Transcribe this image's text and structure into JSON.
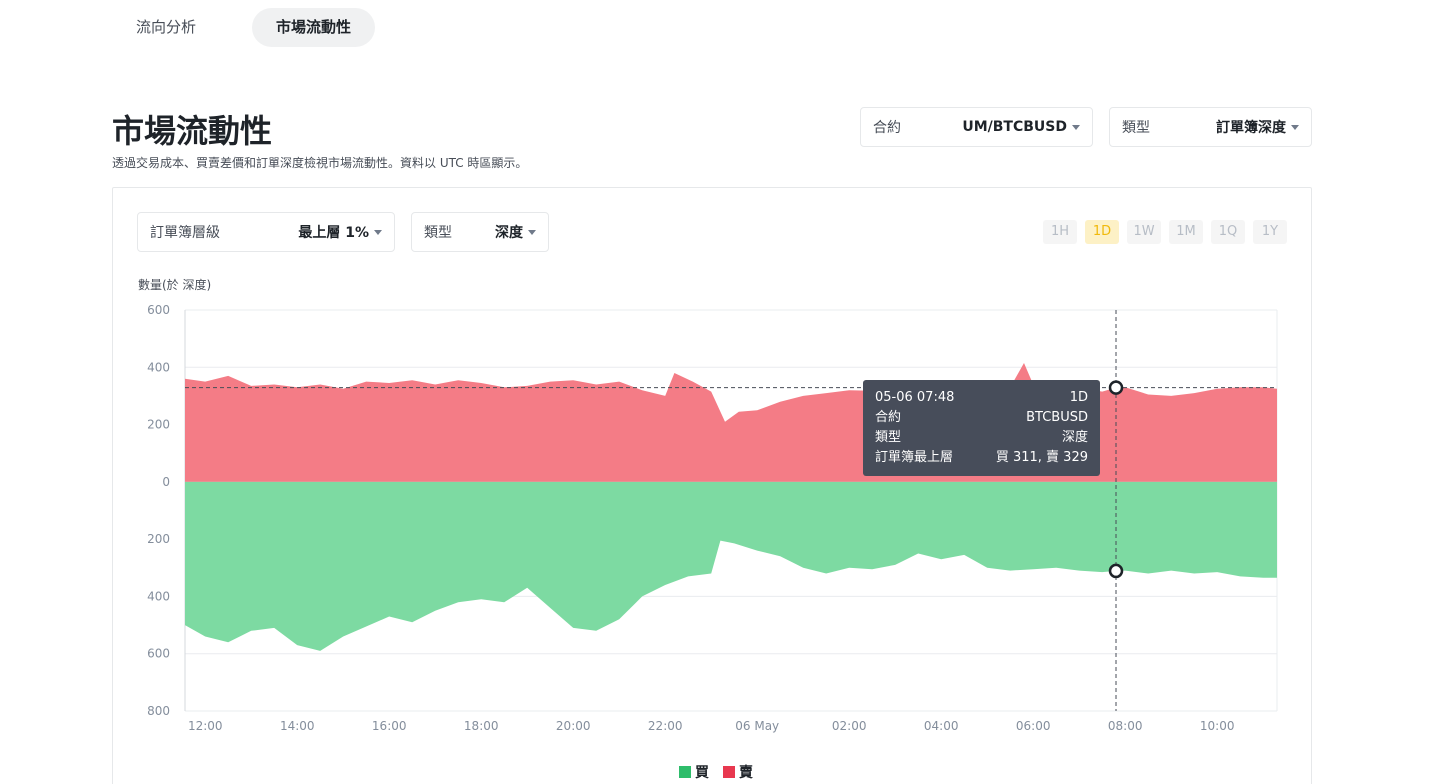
{
  "tabs": [
    {
      "label": "流向分析",
      "active": false
    },
    {
      "label": "市場流動性",
      "active": true
    }
  ],
  "page": {
    "title": "市場流動性",
    "description": "透過交易成本、買賣差價和訂單深度檢視市場流動性。資料以 UTC 時區顯示。"
  },
  "filters": {
    "contract": {
      "label": "合約",
      "value": "UM/BTCBUSD"
    },
    "type": {
      "label": "類型",
      "value": "訂單簿深度"
    },
    "level": {
      "label": "訂單簿層級",
      "value": "最上層 1%"
    },
    "subtype": {
      "label": "類型",
      "value": "深度"
    }
  },
  "periods": [
    {
      "label": "1H",
      "active": false
    },
    {
      "label": "1D",
      "active": true
    },
    {
      "label": "1W",
      "active": false
    },
    {
      "label": "1M",
      "active": false
    },
    {
      "label": "1Q",
      "active": false
    },
    {
      "label": "1Y",
      "active": false
    }
  ],
  "tooltip": {
    "time": "05-06 07:48",
    "period": "1D",
    "contract_label": "合約",
    "contract_value": "BTCBUSD",
    "type_label": "類型",
    "type_value": "深度",
    "level_label": "訂單簿最上層",
    "level_value": "買 311, 賣 329"
  },
  "colors": {
    "buy": "#7ddaa2",
    "sell": "#f47c86",
    "buy_legend": "#2ebd6b",
    "sell_legend": "#e8384f"
  },
  "chart_data": {
    "type": "area",
    "ylabel": "數量(於 深度)",
    "ylim": [
      -800,
      600
    ],
    "y_ticks": [
      600,
      400,
      200,
      0,
      -200,
      -400,
      -600,
      -800
    ],
    "y_tick_labels": [
      "600",
      "400",
      "200",
      "0",
      "200",
      "400",
      "600",
      "800"
    ],
    "x_ticks": [
      {
        "t": 0,
        "label": "12:00"
      },
      {
        "t": 2,
        "label": "14:00"
      },
      {
        "t": 4,
        "label": "16:00"
      },
      {
        "t": 6,
        "label": "18:00"
      },
      {
        "t": 8,
        "label": "20:00"
      },
      {
        "t": 10,
        "label": "22:00"
      },
      {
        "t": 12,
        "label": "06 May"
      },
      {
        "t": 14,
        "label": "02:00"
      },
      {
        "t": 16,
        "label": "04:00"
      },
      {
        "t": 18,
        "label": "06:00"
      },
      {
        "t": 20,
        "label": "08:00"
      },
      {
        "t": 22,
        "label": "10:00"
      }
    ],
    "xlim": [
      -0.44,
      23.3
    ],
    "crosshair_t": 19.8,
    "crosshair_value": 329,
    "series": [
      {
        "name": "賣",
        "x": [
          -0.44,
          0,
          0.5,
          1,
          1.5,
          2,
          2.5,
          3,
          3.5,
          4,
          4.5,
          5,
          5.5,
          6,
          6.5,
          7,
          7.5,
          8,
          8.5,
          9,
          9.5,
          10,
          10.2,
          10.6,
          11,
          11.3,
          11.6,
          12,
          12.5,
          13,
          13.5,
          14,
          14.5,
          15,
          15.5,
          16,
          16.5,
          17,
          17.5,
          17.8,
          18,
          18.5,
          19,
          19.5,
          19.8,
          20,
          20.5,
          21,
          21.5,
          22,
          22.5,
          23,
          23.3
        ],
        "values": [
          360,
          350,
          370,
          335,
          340,
          330,
          340,
          325,
          350,
          345,
          355,
          340,
          355,
          345,
          330,
          335,
          350,
          355,
          340,
          350,
          320,
          300,
          380,
          350,
          315,
          210,
          245,
          250,
          280,
          300,
          310,
          320,
          318,
          322,
          315,
          320,
          335,
          345,
          330,
          415,
          340,
          335,
          330,
          315,
          329,
          330,
          305,
          300,
          310,
          325,
          330,
          330,
          325
        ]
      },
      {
        "name": "買",
        "x": [
          -0.44,
          0,
          0.5,
          1,
          1.5,
          2,
          2.5,
          3,
          3.5,
          4,
          4.5,
          5,
          5.5,
          6,
          6.5,
          7,
          7.5,
          8,
          8.5,
          9,
          9.5,
          10,
          10.5,
          11,
          11.2,
          11.5,
          12,
          12.5,
          13,
          13.5,
          14,
          14.5,
          15,
          15.5,
          16,
          16.5,
          17,
          17.5,
          18,
          18.5,
          19,
          19.5,
          19.8,
          20,
          20.5,
          21,
          21.5,
          22,
          22.5,
          23,
          23.3
        ],
        "values": [
          -500,
          -540,
          -560,
          -520,
          -510,
          -570,
          -590,
          -540,
          -505,
          -470,
          -490,
          -450,
          -420,
          -410,
          -420,
          -370,
          -440,
          -510,
          -520,
          -480,
          -400,
          -360,
          -330,
          -320,
          -205,
          -215,
          -240,
          -260,
          -300,
          -320,
          -300,
          -305,
          -290,
          -250,
          -270,
          -255,
          -300,
          -310,
          -305,
          -300,
          -310,
          -315,
          -311,
          -310,
          -320,
          -310,
          -320,
          -315,
          -330,
          -335,
          -335
        ]
      }
    ]
  },
  "legend": [
    {
      "name": "買",
      "color_key": "buy_legend"
    },
    {
      "name": "賣",
      "color_key": "sell_legend"
    }
  ]
}
